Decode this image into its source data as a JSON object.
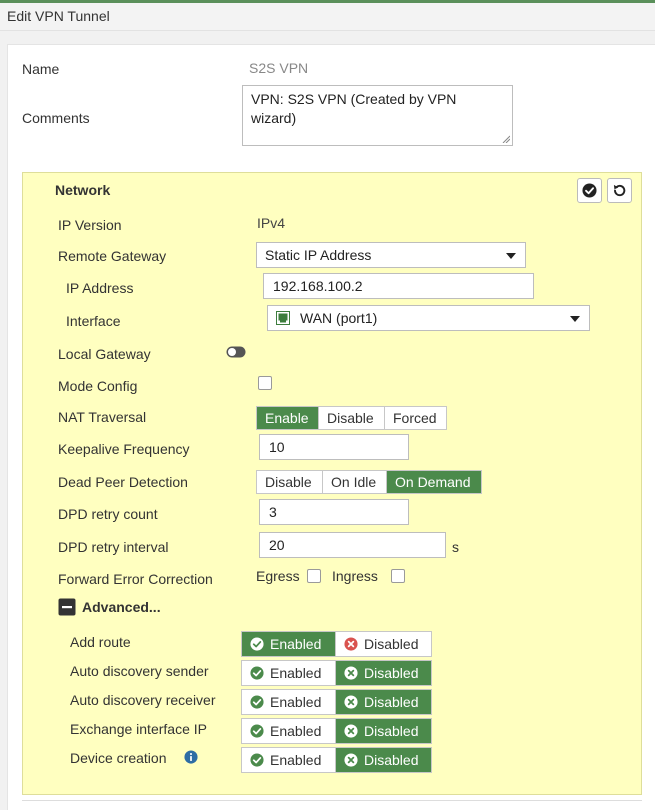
{
  "window": {
    "title": "Edit VPN Tunnel"
  },
  "form": {
    "name_label": "Name",
    "name_value": "S2S VPN",
    "comments_label": "Comments",
    "comments_value": "VPN: S2S VPN (Created by VPN wizard)"
  },
  "network": {
    "title": "Network",
    "ip_version_label": "IP Version",
    "ip_version_value": "IPv4",
    "remote_gateway_label": "Remote Gateway",
    "remote_gateway_value": "Static IP Address",
    "ip_address_label": "IP Address",
    "ip_address_value": "192.168.100.2",
    "interface_label": "Interface",
    "interface_value": "WAN (port1)",
    "local_gateway_label": "Local Gateway",
    "local_gateway_enabled": false,
    "mode_config_label": "Mode Config",
    "mode_config_checked": false,
    "nat_traversal_label": "NAT Traversal",
    "nat_traversal_options": [
      "Enable",
      "Disable",
      "Forced"
    ],
    "nat_traversal_selected": "Enable",
    "keepalive_label": "Keepalive Frequency",
    "keepalive_value": "10",
    "dpd_label": "Dead Peer Detection",
    "dpd_options": [
      "Disable",
      "On Idle",
      "On Demand"
    ],
    "dpd_selected": "On Demand",
    "dpd_retry_count_label": "DPD retry count",
    "dpd_retry_count_value": "3",
    "dpd_retry_interval_label": "DPD retry interval",
    "dpd_retry_interval_value": "20",
    "dpd_retry_interval_unit": "s",
    "fec_label": "Forward Error Correction",
    "fec_egress_label": "Egress",
    "fec_ingress_label": "Ingress",
    "advanced_label": "Advanced...",
    "enabled_label": "Enabled",
    "disabled_label": "Disabled",
    "advanced_rows": [
      {
        "label": "Add route",
        "selected": "Enabled"
      },
      {
        "label": "Auto discovery sender",
        "selected": "Disabled"
      },
      {
        "label": "Auto discovery receiver",
        "selected": "Disabled"
      },
      {
        "label": "Exchange interface IP",
        "selected": "Disabled"
      },
      {
        "label": "Device creation",
        "selected": "Disabled",
        "info": true
      }
    ]
  },
  "colors": {
    "accent_green": "#4b8a4b",
    "panel_yellow": "#ffffc0",
    "disabled_red": "#d9534f",
    "info_blue": "#2e6da4"
  }
}
